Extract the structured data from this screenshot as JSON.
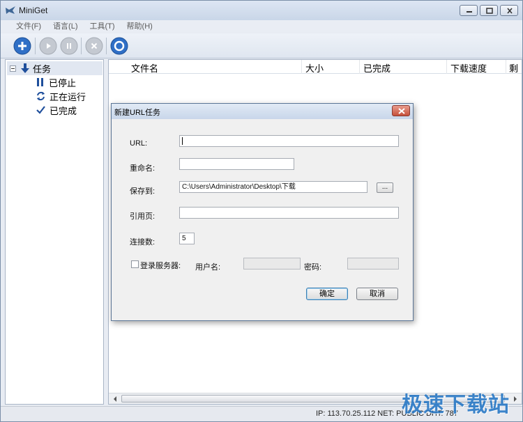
{
  "window": {
    "title": "MiniGet"
  },
  "menu": {
    "items": [
      "文件(F)",
      "语言(L)",
      "工具(T)",
      "帮助(H)"
    ]
  },
  "toolbar": {
    "buttons": [
      "add-icon",
      "play-icon",
      "pause-icon",
      "delete-icon",
      "settings-icon"
    ],
    "colors": {
      "active": "#2f6fc6",
      "disabled": "#b9bec6"
    }
  },
  "tree": {
    "root": "任务",
    "items": [
      "已停止",
      "正在运行",
      "已完成"
    ]
  },
  "list": {
    "columns": [
      "文件名",
      "大小",
      "已完成",
      "下载速度",
      "剩"
    ]
  },
  "status": {
    "text": "IP: 113.70.25.112 NET: PUBLIC  DHT: 787"
  },
  "watermark": "极速下载站",
  "dialog": {
    "title": "新建URL任务",
    "url_label": "URL:",
    "url_value": "",
    "rename_label": "重命名:",
    "rename_value": "",
    "save_label": "保存到:",
    "save_value": "C:\\Users\\Administrator\\Desktop\\下载",
    "browse_label": "...",
    "referer_label": "引用页:",
    "referer_value": "",
    "connections_label": "连接数:",
    "connections_value": "5",
    "login_label": "登录服务器:",
    "username_label": "用户名:",
    "password_label": "密码:",
    "ok_label": "确定",
    "cancel_label": "取消"
  }
}
